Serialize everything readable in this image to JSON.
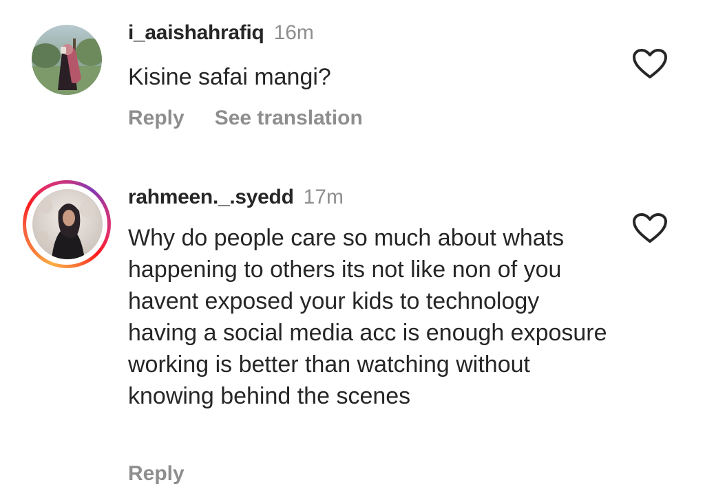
{
  "comments": [
    {
      "username": "i_aaishahrafiq",
      "time": "16m",
      "text": "Kisine safai mangi?",
      "reply_label": "Reply",
      "translate_label": "See translation",
      "avatar_icon": "user-photo-avatar",
      "like_icon": "heart-outline-icon",
      "has_story_ring": false
    },
    {
      "username": "rahmeen._.syedd",
      "time": "17m",
      "text": "Why do people care so much about whats happening to others its not like non of you havent exposed your kids to technology having a social media acc is enough exposure working is better than watching without knowing behind the scenes",
      "reply_label": "Reply",
      "avatar_icon": "user-photo-avatar",
      "like_icon": "heart-outline-icon",
      "has_story_ring": true
    }
  ],
  "colors": {
    "text_primary": "#262626",
    "text_secondary": "#8e8e8e",
    "background": "#ffffff",
    "story_ring_start": "#fcaf45",
    "story_ring_end": "#c13584"
  }
}
